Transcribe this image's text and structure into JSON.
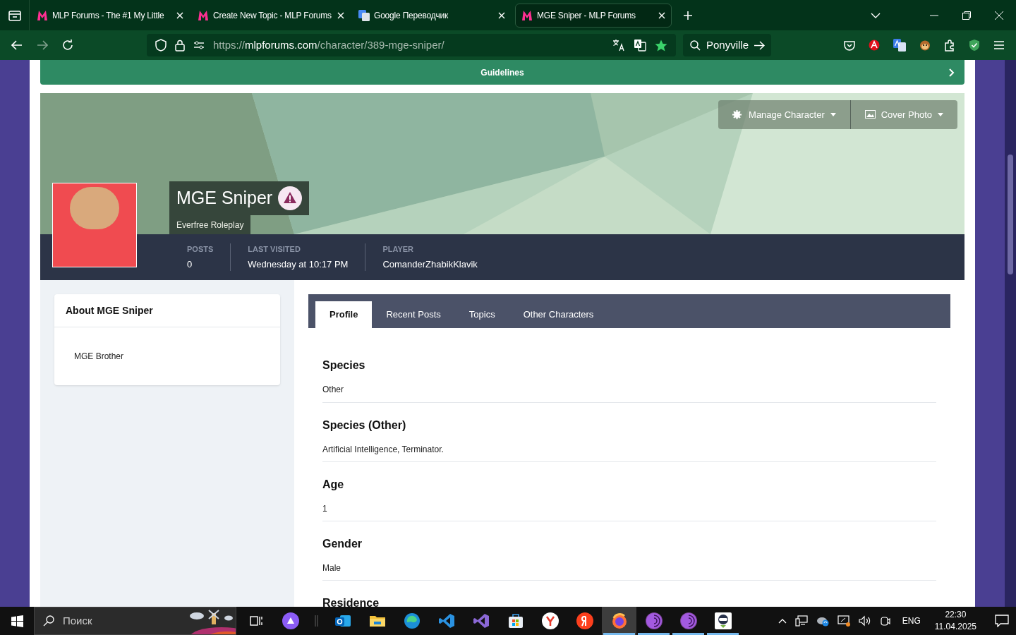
{
  "browser": {
    "tabs": [
      {
        "title": "MLP Forums - The #1 My Little",
        "kind": "forum",
        "selected": false
      },
      {
        "title": "Create New Topic - MLP Forums",
        "kind": "forum",
        "selected": false
      },
      {
        "title": "Google Переводчик",
        "kind": "translate",
        "selected": false
      },
      {
        "title": "MGE Sniper - MLP Forums",
        "kind": "forum",
        "selected": true
      }
    ],
    "url": {
      "scheme": "https://",
      "host": "mlpforums.com",
      "path": "/character/389-mge-sniper/"
    },
    "search": {
      "value": "Ponyville"
    }
  },
  "page": {
    "guidelines": "Guidelines",
    "character": {
      "name": "MGE Sniper",
      "group": "Everfree Roleplay",
      "stats": [
        {
          "label": "POSTS",
          "value": "0"
        },
        {
          "label": "LAST VISITED",
          "value": "Wednesday at 10:17 PM"
        },
        {
          "label": "PLAYER",
          "value": "ComanderZhabikKlavik"
        }
      ]
    },
    "cover_buttons": [
      {
        "label": "Manage Character",
        "kind": "gear"
      },
      {
        "label": "Cover Photo",
        "kind": "image"
      }
    ],
    "about": {
      "title": "About MGE Sniper",
      "text": "MGE Brother"
    },
    "profile_tabs": [
      {
        "label": "Profile",
        "selected": true
      },
      {
        "label": "Recent Posts",
        "selected": false
      },
      {
        "label": "Topics",
        "selected": false
      },
      {
        "label": "Other Characters",
        "selected": false
      }
    ],
    "fields": [
      {
        "label": "Species",
        "value": "Other"
      },
      {
        "label": "Species (Other)",
        "value": "Artificial Intelligence, Terminator."
      },
      {
        "label": "Age",
        "value": "1"
      },
      {
        "label": "Gender",
        "value": "Male"
      },
      {
        "label": "Residence"
      }
    ]
  },
  "taskbar": {
    "search_placeholder": "Поиск",
    "apps": [
      {
        "kind": "task-view",
        "running": false,
        "selected": false
      },
      {
        "kind": "assistant",
        "running": false,
        "selected": false
      },
      {
        "kind": "mail",
        "running": false,
        "selected": false
      },
      {
        "kind": "folder",
        "running": false,
        "selected": false
      },
      {
        "kind": "edge",
        "running": false,
        "selected": false
      },
      {
        "kind": "code",
        "running": false,
        "selected": false
      },
      {
        "kind": "studio",
        "running": false,
        "selected": false
      },
      {
        "kind": "store",
        "running": false,
        "selected": false
      },
      {
        "kind": "y-browser",
        "running": false,
        "selected": false
      },
      {
        "kind": "y-search",
        "running": false,
        "selected": false
      },
      {
        "kind": "firefox",
        "running": true,
        "selected": true
      },
      {
        "kind": "tor",
        "running": true,
        "selected": false
      },
      {
        "kind": "tor",
        "running": true,
        "selected": false
      },
      {
        "kind": "vpn",
        "running": true,
        "selected": false
      }
    ],
    "lang": "ENG",
    "time": "22:30",
    "date": "11.04.2025"
  }
}
